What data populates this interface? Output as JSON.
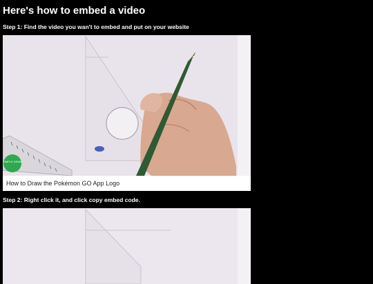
{
  "page": {
    "title": "Here's how to embed a video"
  },
  "steps": [
    {
      "label": "Step 1: Find the video you wan't to embed and put on your website"
    },
    {
      "label": "Step 2: Right click it, and click copy embed code."
    }
  ],
  "videos": [
    {
      "caption": "How to Draw the Pokémon GO App Logo",
      "channel_badge_text": "SIMPLE DRAW"
    }
  ],
  "colors": {
    "background": "#000000",
    "text": "#ffffff",
    "caption_text": "#222222",
    "paper": "#ede8ef",
    "pencil": "#2f5a34",
    "badge": "#2fa84f"
  }
}
